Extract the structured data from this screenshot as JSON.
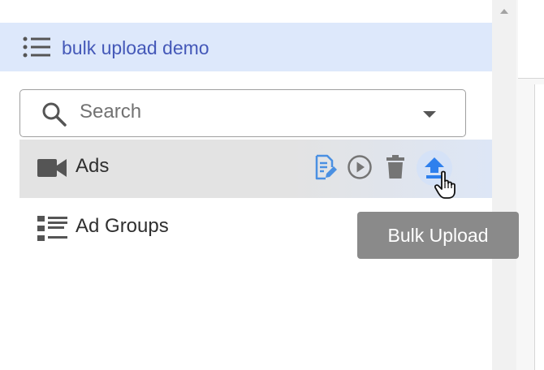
{
  "header": {
    "title": "bulk upload demo",
    "icon": "list-icon"
  },
  "search": {
    "placeholder": "Search",
    "icon": "search-icon",
    "dropdown_icon": "caret-down-icon"
  },
  "items": [
    {
      "label": "Ads",
      "icon": "video-camera-icon",
      "actions": [
        {
          "name": "edit",
          "icon": "edit-document-icon",
          "color": "#4a90e2"
        },
        {
          "name": "play",
          "icon": "play-circle-icon",
          "color": "#757575"
        },
        {
          "name": "delete",
          "icon": "trash-icon",
          "color": "#757575"
        },
        {
          "name": "bulk-upload",
          "icon": "upload-icon",
          "color": "#2f80ed"
        }
      ]
    },
    {
      "label": "Ad Groups",
      "icon": "list-view-icon"
    }
  ],
  "tooltip": {
    "text": "Bulk Upload"
  },
  "colors": {
    "header_bg": "#dde8fb",
    "header_text": "#4458b8",
    "selected_row_bg": "#e3e3e3",
    "tooltip_bg": "#8a8a8a",
    "accent": "#2f80ed"
  }
}
